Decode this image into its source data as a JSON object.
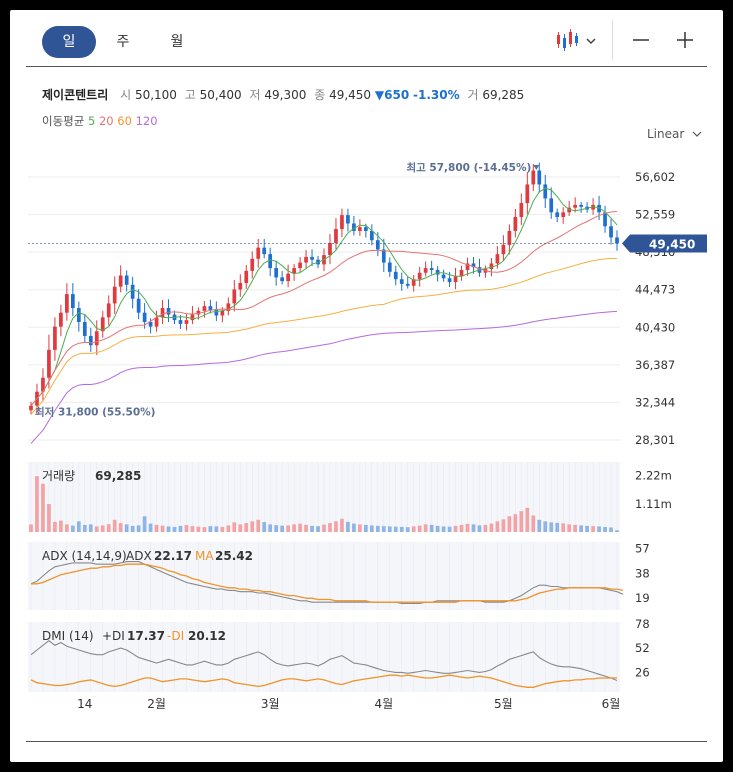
{
  "tabs": {
    "day": "일",
    "week": "주",
    "month": "월"
  },
  "toolbar": {
    "chart_type_icon": "candlestick-icon",
    "zoom_out_icon": "minus-icon",
    "zoom_in_icon": "plus-icon"
  },
  "quote": {
    "name": "제이콘텐트리",
    "open_label": "시",
    "open": "50,100",
    "high_label": "고",
    "high": "50,400",
    "low_label": "저",
    "low": "49,300",
    "close_label": "종",
    "close": "49,450",
    "change": "▼650",
    "change_pct": "-1.30%",
    "volume_label": "거",
    "volume": "69,285"
  },
  "ma_legend": {
    "label": "이동평균",
    "p5": "5",
    "p20": "20",
    "p60": "60",
    "p120": "120"
  },
  "scale_mode": "Linear",
  "colors": {
    "up": "#e0393e",
    "down": "#1e6fcf",
    "ma5": "#4caf50",
    "ma20": "#e57373",
    "ma60": "#f5b041",
    "ma120": "#b36be0",
    "accent": "#2f5597",
    "adx": "#888888",
    "adx_ma": "#f0932b"
  },
  "chart_data": {
    "type": "candlestick",
    "price_ticks": [
      "56,602",
      "52,559",
      "48,516",
      "44,473",
      "40,430",
      "36,387",
      "32,344",
      "28,301"
    ],
    "price_tick_values": [
      56602,
      52559,
      48516,
      44473,
      40430,
      36387,
      32344,
      28301
    ],
    "current_price_tag": "49,450",
    "max_marker": "최고 57,800 (-14.45%)",
    "min_marker": "최저 31,800 (55.50%)",
    "x_ticks": [
      "14",
      "2월",
      "3월",
      "4월",
      "5월",
      "6월"
    ],
    "closes": [
      32000,
      33500,
      35000,
      38000,
      40500,
      42000,
      44000,
      42500,
      41000,
      39500,
      38500,
      40000,
      41500,
      43000,
      44800,
      46000,
      45000,
      43500,
      42000,
      41000,
      40500,
      41500,
      42500,
      41800,
      41200,
      40800,
      41200,
      41800,
      42200,
      42700,
      42300,
      41700,
      42200,
      43000,
      44500,
      45200,
      46500,
      47800,
      49000,
      48300,
      46800,
      45800,
      45400,
      46200,
      46800,
      47400,
      48000,
      47700,
      47200,
      48200,
      49500,
      51000,
      52500,
      51600,
      50800,
      51200,
      50800,
      49800,
      48800,
      47400,
      46400,
      45600,
      45100,
      44900,
      45600,
      46300,
      46800,
      46600,
      46100,
      45700,
      45300,
      45900,
      46600,
      47300,
      46900,
      46300,
      46700,
      47300,
      48300,
      49300,
      50800,
      52300,
      53800,
      55800,
      57300,
      55800,
      54300,
      52800,
      52300,
      52800,
      53300,
      53600,
      53400,
      53100,
      53600,
      52800,
      51300,
      50100,
      49450
    ],
    "ma_legend_periods": [
      5,
      20,
      60,
      120
    ],
    "volume": {
      "title": "거래량",
      "value": "69,285",
      "ticks": [
        "2.22m",
        "1.11m"
      ],
      "tick_values": [
        2220000,
        1110000
      ],
      "values": [
        300000,
        2200000,
        1900000,
        1100000,
        400000,
        450000,
        300000,
        250000,
        420000,
        280000,
        300000,
        220000,
        260000,
        310000,
        480000,
        350000,
        300000,
        240000,
        260000,
        620000,
        330000,
        280000,
        250000,
        220000,
        200000,
        240000,
        270000,
        230000,
        210000,
        190000,
        230000,
        220000,
        200000,
        260000,
        380000,
        300000,
        350000,
        420000,
        480000,
        390000,
        300000,
        270000,
        250000,
        260000,
        300000,
        330000,
        280000,
        240000,
        230000,
        290000,
        350000,
        420000,
        520000,
        400000,
        330000,
        300000,
        280000,
        260000,
        240000,
        230000,
        220000,
        210000,
        200000,
        190000,
        220000,
        250000,
        300000,
        280000,
        240000,
        220000,
        210000,
        240000,
        280000,
        320000,
        300000,
        260000,
        280000,
        330000,
        420000,
        500000,
        620000,
        700000,
        820000,
        950000,
        650000,
        480000,
        420000,
        380000,
        360000,
        340000,
        300000,
        280000,
        260000,
        240000,
        230000,
        220000,
        200000,
        180000,
        69285
      ]
    },
    "adx": {
      "title": "ADX (14,14,9)",
      "adx_label": "ADX",
      "adx_value": "22.17",
      "ma_label": "MA",
      "ma_value": "25.42",
      "ticks": [
        "57",
        "38",
        "19"
      ],
      "tick_values": [
        57,
        38,
        19
      ],
      "adx_series": [
        30,
        32,
        36,
        40,
        43,
        44,
        45,
        46,
        46,
        46,
        46,
        45,
        45,
        45,
        45,
        46,
        47,
        47,
        47,
        45,
        43,
        41,
        39,
        37,
        35,
        33,
        31,
        30,
        29,
        28,
        27,
        26,
        26,
        25,
        25,
        24,
        24,
        24,
        23,
        23,
        22,
        21,
        20,
        19,
        18,
        17,
        17,
        16,
        16,
        16,
        16,
        16,
        16,
        16,
        16,
        16,
        16,
        16,
        16,
        16,
        16,
        16,
        15,
        15,
        15,
        15,
        16,
        16,
        17,
        17,
        17,
        17,
        17,
        17,
        17,
        17,
        16,
        16,
        16,
        16,
        17,
        19,
        21,
        24,
        27,
        29,
        29,
        28,
        28,
        27,
        27,
        27,
        27,
        27,
        27,
        27,
        26,
        25,
        24,
        22
      ],
      "ma_series": [
        30,
        30,
        31,
        33,
        35,
        37,
        38,
        39,
        40,
        41,
        42,
        42,
        43,
        43,
        44,
        44,
        45,
        45,
        45,
        45,
        44,
        43,
        42,
        40,
        39,
        37,
        36,
        34,
        33,
        31,
        30,
        29,
        28,
        27,
        27,
        26,
        26,
        25,
        25,
        24,
        24,
        23,
        22,
        21,
        21,
        20,
        19,
        19,
        18,
        18,
        18,
        17,
        17,
        17,
        17,
        17,
        17,
        16,
        16,
        16,
        16,
        16,
        16,
        16,
        16,
        16,
        16,
        16,
        16,
        16,
        16,
        16,
        17,
        17,
        17,
        17,
        17,
        17,
        17,
        17,
        17,
        17,
        18,
        19,
        21,
        23,
        24,
        25,
        26,
        26,
        27,
        27,
        27,
        27,
        27,
        27,
        27,
        26,
        26,
        25
      ]
    },
    "dmi": {
      "title": "DMI (14)",
      "pdi_label": "+DI",
      "pdi_value": "17.37",
      "mdi_label": "-DI",
      "mdi_value": "20.12",
      "ticks": [
        "78",
        "52",
        "26"
      ],
      "tick_values": [
        78,
        52,
        26
      ],
      "pdi_series": [
        45,
        50,
        55,
        60,
        55,
        58,
        54,
        52,
        50,
        48,
        46,
        45,
        45,
        48,
        50,
        52,
        50,
        46,
        42,
        40,
        38,
        36,
        38,
        40,
        38,
        36,
        34,
        34,
        36,
        38,
        36,
        34,
        34,
        36,
        40,
        42,
        44,
        46,
        48,
        45,
        40,
        36,
        34,
        33,
        34,
        35,
        36,
        35,
        33,
        36,
        40,
        42,
        44,
        40,
        36,
        35,
        34,
        32,
        30,
        28,
        27,
        26,
        26,
        25,
        26,
        27,
        28,
        27,
        26,
        25,
        25,
        26,
        27,
        28,
        27,
        26,
        27,
        29,
        33,
        36,
        40,
        42,
        44,
        46,
        48,
        42,
        38,
        35,
        33,
        32,
        32,
        31,
        30,
        28,
        26,
        24,
        22,
        20,
        17.37
      ],
      "mdi_series": [
        18,
        15,
        14,
        13,
        12,
        12,
        13,
        14,
        16,
        17,
        18,
        16,
        14,
        12,
        11,
        12,
        14,
        16,
        18,
        20,
        20,
        18,
        16,
        17,
        18,
        19,
        19,
        18,
        17,
        16,
        17,
        18,
        19,
        18,
        15,
        14,
        13,
        12,
        11,
        12,
        14,
        16,
        18,
        19,
        19,
        18,
        17,
        18,
        19,
        18,
        16,
        14,
        13,
        15,
        17,
        18,
        19,
        20,
        21,
        22,
        23,
        23,
        22,
        23,
        22,
        21,
        20,
        20,
        21,
        22,
        23,
        22,
        21,
        20,
        21,
        22,
        21,
        20,
        18,
        16,
        14,
        12,
        11,
        10,
        10,
        12,
        14,
        15,
        16,
        17,
        17,
        18,
        18,
        19,
        19,
        20,
        20,
        20,
        20.12
      ]
    }
  }
}
